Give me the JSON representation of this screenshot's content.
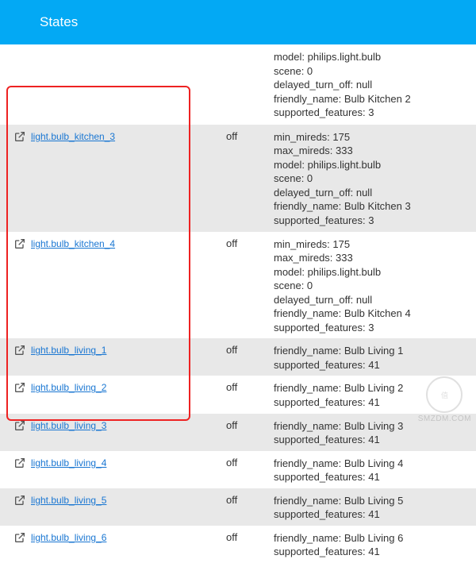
{
  "header": {
    "title": "States"
  },
  "partial_top_attrs": [
    "model: philips.light.bulb",
    "scene: 0",
    "delayed_turn_off: null",
    "friendly_name: Bulb Kitchen 2",
    "supported_features: 3"
  ],
  "rows": [
    {
      "entity": "light.bulb_kitchen_3",
      "state": "off",
      "attrs": [
        "min_mireds: 175",
        "max_mireds: 333",
        "model: philips.light.bulb",
        "scene: 0",
        "delayed_turn_off: null",
        "friendly_name: Bulb Kitchen 3",
        "supported_features: 3"
      ]
    },
    {
      "entity": "light.bulb_kitchen_4",
      "state": "off",
      "attrs": [
        "min_mireds: 175",
        "max_mireds: 333",
        "model: philips.light.bulb",
        "scene: 0",
        "delayed_turn_off: null",
        "friendly_name: Bulb Kitchen 4",
        "supported_features: 3"
      ]
    },
    {
      "entity": "light.bulb_living_1",
      "state": "off",
      "attrs": [
        "friendly_name: Bulb Living 1",
        "supported_features: 41"
      ]
    },
    {
      "entity": "light.bulb_living_2",
      "state": "off",
      "attrs": [
        "friendly_name: Bulb Living 2",
        "supported_features: 41"
      ]
    },
    {
      "entity": "light.bulb_living_3",
      "state": "off",
      "attrs": [
        "friendly_name: Bulb Living 3",
        "supported_features: 41"
      ]
    },
    {
      "entity": "light.bulb_living_4",
      "state": "off",
      "attrs": [
        "friendly_name: Bulb Living 4",
        "supported_features: 41"
      ]
    },
    {
      "entity": "light.bulb_living_5",
      "state": "off",
      "attrs": [
        "friendly_name: Bulb Living 5",
        "supported_features: 41"
      ]
    },
    {
      "entity": "light.bulb_living_6",
      "state": "off",
      "attrs": [
        "friendly_name: Bulb Living 6",
        "supported_features: 41"
      ]
    }
  ],
  "watermark": {
    "inner": "值",
    "sub": "什么值得买",
    "domain": "SMZDM.COM"
  }
}
